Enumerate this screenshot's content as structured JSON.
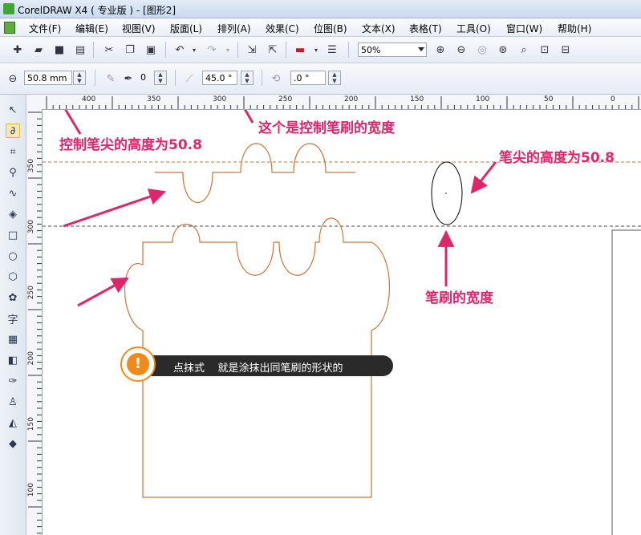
{
  "window": {
    "title": "CorelDRAW X4 ( 专业版 ) - [图形2]"
  },
  "menu": [
    "文件(F)",
    "编辑(E)",
    "视图(V)",
    "版面(L)",
    "排列(A)",
    "效果(C)",
    "位图(B)",
    "文本(X)",
    "表格(T)",
    "工具(O)",
    "窗口(W)",
    "帮助(H)"
  ],
  "toolbar": {
    "zoom_value": "50%"
  },
  "property_bar": {
    "nib_height": "50.8 mm",
    "pressure_value": "0",
    "angle_value": "45.0 °",
    "rotation_value": ".0 °"
  },
  "ruler": {
    "h_labels": [
      "400",
      "350",
      "300",
      "250",
      "200",
      "150",
      "100",
      "50",
      "0"
    ],
    "v_labels": [
      "350",
      "300",
      "250",
      "200",
      "150",
      "100"
    ]
  },
  "annotations": {
    "nib_height": "控制笔尖的高度为50.8",
    "brush_width_control": "这个是控制笔刷的宽度",
    "nib_height_right": "笔尖的高度为50.8",
    "brush_width": "笔刷的宽度"
  },
  "tip": {
    "text": "点抹式    就是涂抹出同笔刷的形状的",
    "icon": "!"
  },
  "colors": {
    "annotation": "#e0266b",
    "shape_stroke": "#c8763a",
    "tip_accent": "#f08a1c"
  }
}
